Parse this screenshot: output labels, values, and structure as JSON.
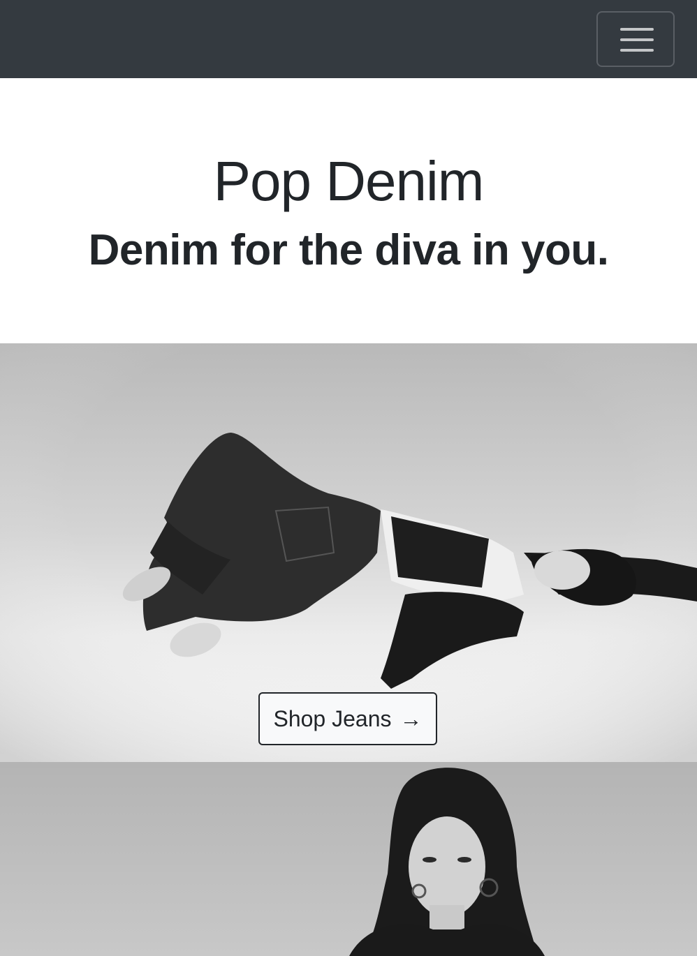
{
  "navbar": {
    "toggler_icon": "hamburger-menu-icon",
    "background": "#343a40"
  },
  "hero": {
    "title": "Pop Denim",
    "subtitle": "Denim for the diva in you."
  },
  "cta": {
    "label": "Shop Jeans",
    "arrow": "→",
    "icon": "arrow-right-icon"
  },
  "photos": [
    {
      "name": "denim-model-lying-photo",
      "style": "black-and-white"
    },
    {
      "name": "denim-model-portrait-photo",
      "style": "black-and-white"
    }
  ]
}
